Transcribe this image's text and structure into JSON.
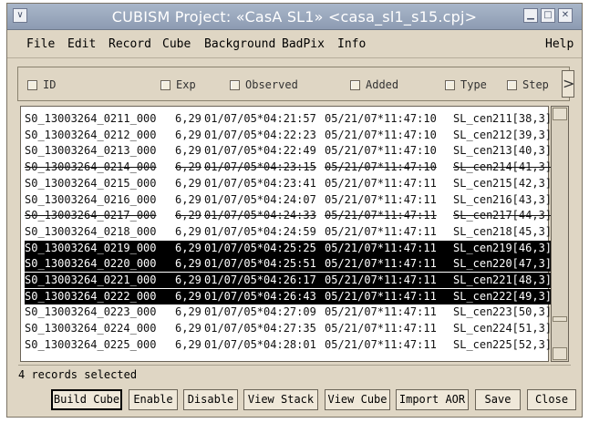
{
  "window": {
    "title": "CUBISM Project: «CasA SL1»  <casa_sl1_s15.cpj>",
    "menu_icon": "chevron-down-icon",
    "controls": [
      "minimize-icon",
      "maximize-icon",
      "close-icon"
    ]
  },
  "menubar": {
    "items": [
      "File",
      "Edit",
      "Record",
      "Cube",
      "Background",
      "BadPix",
      "Info"
    ],
    "help": "Help"
  },
  "columns": [
    {
      "label": "ID",
      "checked": false
    },
    {
      "label": "Exp",
      "checked": false
    },
    {
      "label": "Observed",
      "checked": false
    },
    {
      "label": "Added",
      "checked": false
    },
    {
      "label": "Type",
      "checked": false
    },
    {
      "label": "Step",
      "checked": false
    }
  ],
  "records": [
    {
      "id": "S0_13003264_0211_000",
      "exp": "6,29",
      "observed": "01/07/05*04:21:57",
      "added": "05/21/07*11:47:10",
      "type": "SL_cen",
      "step": "211[38,3]",
      "selected": false,
      "disabled": false
    },
    {
      "id": "S0_13003264_0212_000",
      "exp": "6,29",
      "observed": "01/07/05*04:22:23",
      "added": "05/21/07*11:47:10",
      "type": "SL_cen",
      "step": "212[39,3]",
      "selected": false,
      "disabled": false
    },
    {
      "id": "S0_13003264_0213_000",
      "exp": "6,29",
      "observed": "01/07/05*04:22:49",
      "added": "05/21/07*11:47:10",
      "type": "SL_cen",
      "step": "213[40,3]",
      "selected": false,
      "disabled": false
    },
    {
      "id": "S0_13003264_0214_000",
      "exp": "6,29",
      "observed": "01/07/05*04:23:15",
      "added": "05/21/07*11:47:10",
      "type": "SL_cen",
      "step": "214[41,3]",
      "selected": false,
      "disabled": true
    },
    {
      "id": "S0_13003264_0215_000",
      "exp": "6,29",
      "observed": "01/07/05*04:23:41",
      "added": "05/21/07*11:47:11",
      "type": "SL_cen",
      "step": "215[42,3]",
      "selected": false,
      "disabled": false
    },
    {
      "id": "S0_13003264_0216_000",
      "exp": "6,29",
      "observed": "01/07/05*04:24:07",
      "added": "05/21/07*11:47:11",
      "type": "SL_cen",
      "step": "216[43,3]",
      "selected": false,
      "disabled": false
    },
    {
      "id": "S0_13003264_0217_000",
      "exp": "6,29",
      "observed": "01/07/05*04:24:33",
      "added": "05/21/07*11:47:11",
      "type": "SL_cen",
      "step": "217[44,3]",
      "selected": false,
      "disabled": true
    },
    {
      "id": "S0_13003264_0218_000",
      "exp": "6,29",
      "observed": "01/07/05*04:24:59",
      "added": "05/21/07*11:47:11",
      "type": "SL_cen",
      "step": "218[45,3]",
      "selected": false,
      "disabled": false
    },
    {
      "id": "S0_13003264_0219_000",
      "exp": "6,29",
      "observed": "01/07/05*04:25:25",
      "added": "05/21/07*11:47:11",
      "type": "SL_cen",
      "step": "219[46,3]",
      "selected": true,
      "disabled": false
    },
    {
      "id": "S0_13003264_0220_000",
      "exp": "6,29",
      "observed": "01/07/05*04:25:51",
      "added": "05/21/07*11:47:11",
      "type": "SL_cen",
      "step": "220[47,3]",
      "selected": true,
      "disabled": false
    },
    {
      "id": "S0_13003264_0221_000",
      "exp": "6,29",
      "observed": "01/07/05*04:26:17",
      "added": "05/21/07*11:47:11",
      "type": "SL_cen",
      "step": "221[48,3]",
      "selected": true,
      "disabled": false
    },
    {
      "id": "S0_13003264_0222_000",
      "exp": "6,29",
      "observed": "01/07/05*04:26:43",
      "added": "05/21/07*11:47:11",
      "type": "SL_cen",
      "step": "222[49,3]",
      "selected": true,
      "disabled": false
    },
    {
      "id": "S0_13003264_0223_000",
      "exp": "6,29",
      "observed": "01/07/05*04:27:09",
      "added": "05/21/07*11:47:11",
      "type": "SL_cen",
      "step": "223[50,3]",
      "selected": false,
      "disabled": false
    },
    {
      "id": "S0_13003264_0224_000",
      "exp": "6,29",
      "observed": "01/07/05*04:27:35",
      "added": "05/21/07*11:47:11",
      "type": "SL_cen",
      "step": "224[51,3]",
      "selected": false,
      "disabled": false
    },
    {
      "id": "S0_13003264_0225_000",
      "exp": "6,29",
      "observed": "01/07/05*04:28:01",
      "added": "05/21/07*11:47:11",
      "type": "SL_cen",
      "step": "225[52,3]",
      "selected": false,
      "disabled": false
    }
  ],
  "status": "4 records selected",
  "buttons": [
    "Build Cube",
    "Enable",
    "Disable",
    "View Stack",
    "View Cube",
    "Import AOR",
    "Save",
    "Close"
  ],
  "colors": {
    "titlebar": "#8d9bb2",
    "window_bg": "#dfd6c4",
    "selection": "#000000"
  }
}
